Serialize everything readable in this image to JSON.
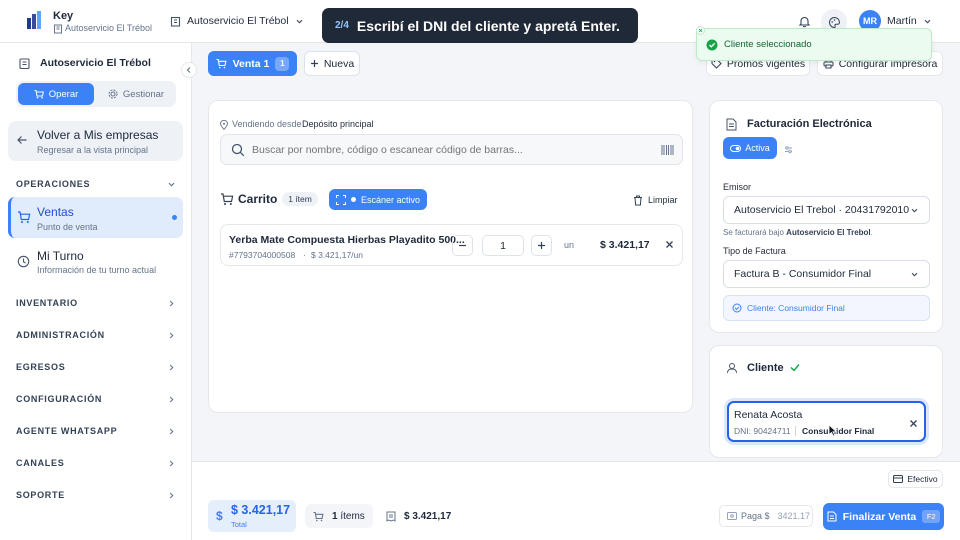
{
  "colors": {
    "accent": "#3b82f6",
    "success": "#16a34a"
  },
  "topbar": {
    "app_name": "Key",
    "company_sub": "Autoservicio El Trébol",
    "store_selector": "Autoservicio El Trébol",
    "user_initials": "MR",
    "user_name": "Martín"
  },
  "tour": {
    "step": "2/4",
    "message": "Escribí el DNI del cliente y apretá Enter."
  },
  "toast": {
    "message": "Cliente seleccionado"
  },
  "sidebar": {
    "store_name": "Autoservicio El Trébol",
    "mode_operar": "Operar",
    "mode_gestionar": "Gestionar",
    "back": {
      "title": "Volver a Mis empresas",
      "subtitle": "Regresar a la vista principal"
    },
    "operaciones": "OPERACIONES",
    "ventas": {
      "title": "Ventas",
      "subtitle": "Punto de venta"
    },
    "turno": {
      "title": "Mi Turno",
      "subtitle": "Información de tu turno actual"
    },
    "sections": [
      "INVENTARIO",
      "ADMINISTRACIÓN",
      "EGRESOS",
      "CONFIGURACIÓN",
      "AGENTE WHATSAPP",
      "CANALES",
      "SOPORTE"
    ]
  },
  "tabs": {
    "sale_label": "Venta 1",
    "sale_badge": "1",
    "new_label": "Nueva"
  },
  "actions": {
    "promos": "Promos vigentes",
    "printer": "Configurar impresora"
  },
  "search": {
    "origin_prefix": "Vendiendo desde",
    "origin_value": "Depósito principal",
    "placeholder": "Buscar por nombre, código o escanear código de barras..."
  },
  "cart": {
    "title": "Carrito",
    "count_badge": "1 ítem",
    "scanner": "Escáner activo",
    "clear": "Limpiar",
    "item": {
      "name": "Yerba Mate Compuesta Hierbas Playadito 500...",
      "code": "#7793704000508",
      "sep": "·",
      "unit_price": "$ 3.421,17/un",
      "qty": "1",
      "unit": "un",
      "total": "$ 3.421,17"
    }
  },
  "invoice": {
    "title": "Facturación Electrónica",
    "status": "Activa",
    "emisor_label": "Emisor",
    "emisor_value": "Autoservicio El Trebol · 20431792010",
    "note_prefix": "Se facturará bajo",
    "note_company": "Autoservicio El Trebol",
    "note_suffix": ".",
    "tipo_label": "Tipo de Factura",
    "tipo_value": "Factura B - Consumidor Final",
    "client_info": "Cliente: Consumidor Final"
  },
  "client": {
    "title": "Cliente",
    "name": "Renata Acosta",
    "dni": "DNI: 90424711",
    "category": "Consumidor Final"
  },
  "payment": {
    "method": "Efectivo"
  },
  "footer": {
    "total": "$ 3.421,17",
    "total_label": "Total",
    "items": "1",
    "items_suffix": "ítems",
    "subtotal": "$ 3.421,17",
    "paga_label": "Paga $",
    "paga_value": "3421.17",
    "finalize": "Finalizar Venta",
    "shortcut": "F2"
  }
}
